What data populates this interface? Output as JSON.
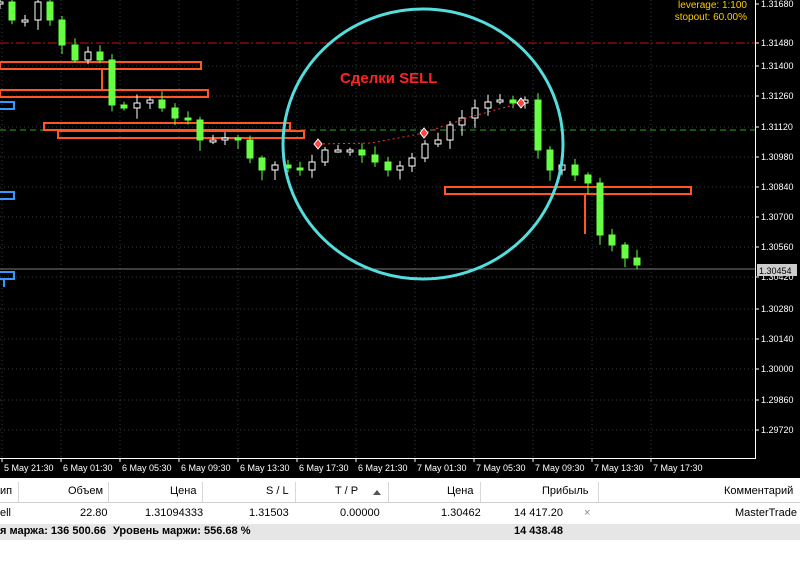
{
  "chart": {
    "annotation": "Сделки SELL",
    "leverage": "leverage: 1:100",
    "stopout": "stopout: 60.00%",
    "current_price": "1.30454",
    "y_ticks": [
      "1.31680",
      "1.31480",
      "1.31400",
      "1.31260",
      "1.31120",
      "1.30980",
      "1.30840",
      "1.30700",
      "1.30560",
      "1.30420",
      "1.30280",
      "1.30140",
      "1.30000",
      "1.29860",
      "1.29720"
    ],
    "x_ticks": [
      "5 May 21:30",
      "6 May 01:30",
      "6 May 05:30",
      "6 May 09:30",
      "6 May 13:30",
      "6 May 17:30",
      "6 May 21:30",
      "7 May 01:30",
      "7 May 05:30",
      "7 May 09:30",
      "7 May 13:30",
      "7 May 17:30"
    ],
    "colors": {
      "background": "#000000",
      "candle_bull": "#ffffff",
      "candle_bear": "#66ff44",
      "grid": "#2f3d3f",
      "sell_zone": "#ff5522",
      "buy_zone": "#3399ff",
      "circle": "#55dddd",
      "annotation": "#ff2222",
      "level_red": "#cc1111",
      "level_green": "#22aa22"
    }
  },
  "table": {
    "headers": {
      "type": "ип",
      "volume": "Объем",
      "open_price": "Цена",
      "sl": "S / L",
      "tp": "T / P",
      "price": "Цена",
      "profit": "Прибыль",
      "comment": "Комментарий"
    },
    "rows": [
      {
        "type": "ell",
        "volume": "22.80",
        "open_price": "1.31094333",
        "sl": "1.31503",
        "tp": "0.00000",
        "price": "1.30462",
        "profit": "14 417.20",
        "comment": "MasterTrade"
      }
    ],
    "summary": {
      "margin_text": "я маржа: 136 500.66",
      "margin_level_text": "Уровень маржи: 556.68 %",
      "total_profit": "14 438.48"
    }
  }
}
